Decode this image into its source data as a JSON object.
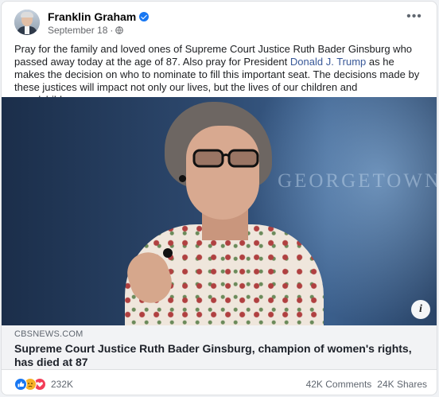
{
  "post": {
    "author": "Franklin Graham",
    "date": "September 18",
    "separator": "·",
    "more_label": "•••",
    "text_before": "Pray for the family and loved ones of Supreme Court Justice Ruth Bader Ginsburg who passed away today at the age of 87. Also pray for President ",
    "mention": "Donald J. Trump",
    "text_after": " as he makes the decision on who to nominate to fill this important seat. The decisions made by these justices will impact not only our lives, but the lives of our children and grandchildren."
  },
  "media": {
    "backdrop_text": "GEORGETOWN",
    "info_label": "i"
  },
  "link": {
    "source": "CBSNEWS.COM",
    "headline": "Supreme Court Justice Ruth Bader Ginsburg, champion of women's rights, has died at 87"
  },
  "footer": {
    "reaction_icons": [
      "like-icon",
      "sad-icon",
      "love-icon"
    ],
    "reaction_count": "232K",
    "comments": "42K Comments",
    "shares": "24K Shares"
  },
  "colors": {
    "accent": "#1877f2",
    "mention": "#385898",
    "like": "#1877f2",
    "sad": "#f7b125",
    "love": "#f33e58"
  }
}
